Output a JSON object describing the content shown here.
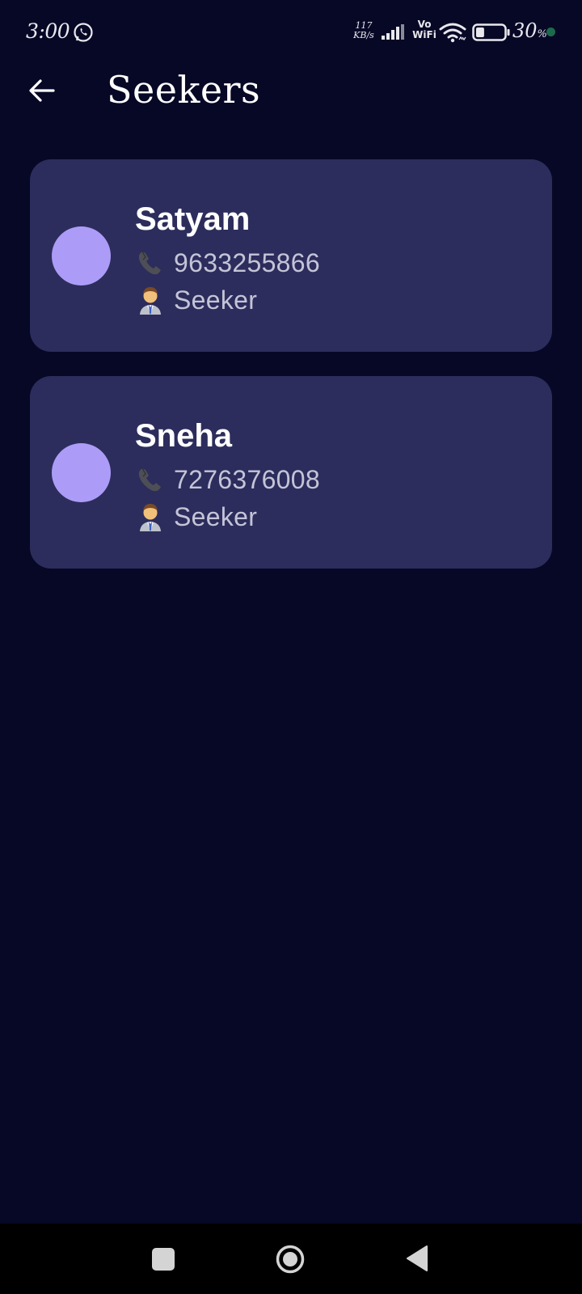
{
  "status_bar": {
    "time": "3:00",
    "net_speed_value": "117",
    "net_speed_unit": "KB/s",
    "vowifi_top": "Vo",
    "vowifi_bottom": "WiFi",
    "battery_value": "30",
    "battery_unit": "%",
    "battery_level": 0.3,
    "icons": [
      "whatsapp-icon",
      "signal-icon",
      "wifi-icon",
      "battery-icon"
    ]
  },
  "app_bar": {
    "title": "Seekers",
    "back_icon": "arrow-back-icon"
  },
  "seekers": [
    {
      "name": "Satyam",
      "phone_emoji": "📞",
      "phone": "9633255866",
      "role_emoji": "👨‍💼",
      "role": "Seeker"
    },
    {
      "name": "Sneha",
      "phone_emoji": "📞",
      "phone": "7276376008",
      "role_emoji": "👨‍💼",
      "role": "Seeker"
    }
  ],
  "colors": {
    "background": "#070826",
    "card": "#2c2d5c",
    "avatar": "#ac9cf8",
    "secondary_text": "#c4c4d8"
  },
  "nav_bar": {
    "buttons": [
      "recents-button",
      "home-button",
      "back-nav-button"
    ]
  }
}
